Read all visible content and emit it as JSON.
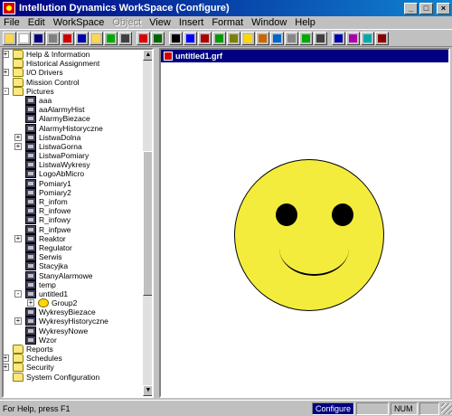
{
  "window": {
    "title": "Intellution Dynamics WorkSpace (Configure)",
    "min_label": "_",
    "max_label": "□",
    "close_label": "×"
  },
  "menu": [
    "File",
    "Edit",
    "WorkSpace",
    "Object",
    "View",
    "Insert",
    "Format",
    "Window",
    "Help"
  ],
  "menu_disabled": [
    "Object"
  ],
  "toolbar_icons": [
    "open-folder-icon",
    "new-icon",
    "save-icon",
    "print-icon",
    "cut-icon",
    "copy-icon",
    "paste-icon",
    "undo-icon",
    "find-icon",
    "draw-tool-icon",
    "scripting-icon",
    "select-icon",
    "rectangle-icon",
    "text-icon",
    "datalink-icon",
    "lock-icon",
    "alarm-icon",
    "chart-icon",
    "bitmap-icon",
    "pushbutton-icon",
    "variable-icon",
    "timer-icon",
    "align-icon",
    "group-icon",
    "ungroup-icon",
    "layer-icon"
  ],
  "tree": {
    "items": [
      {
        "label": "Help & Information",
        "indent": 1,
        "expander": "+",
        "icon": "folder"
      },
      {
        "label": "Historical Assignment",
        "indent": 1,
        "expander": "",
        "icon": "folder"
      },
      {
        "label": "I/O Drivers",
        "indent": 1,
        "expander": "+",
        "icon": "folder"
      },
      {
        "label": "Mission Control",
        "indent": 1,
        "expander": "",
        "icon": "folder"
      },
      {
        "label": "Pictures",
        "indent": 1,
        "expander": "-",
        "icon": "folder"
      },
      {
        "label": "aaa",
        "indent": 2,
        "expander": "",
        "icon": "picture"
      },
      {
        "label": "aaAlarmyHist",
        "indent": 2,
        "expander": "",
        "icon": "picture"
      },
      {
        "label": "AlarmyBiezace",
        "indent": 2,
        "expander": "",
        "icon": "picture"
      },
      {
        "label": "AlarmyHistoryczne",
        "indent": 2,
        "expander": "",
        "icon": "picture"
      },
      {
        "label": "ListwaDolna",
        "indent": 2,
        "expander": "+",
        "icon": "picture"
      },
      {
        "label": "ListwaGorna",
        "indent": 2,
        "expander": "+",
        "icon": "picture"
      },
      {
        "label": "ListwaPomiary",
        "indent": 2,
        "expander": "",
        "icon": "picture"
      },
      {
        "label": "ListwaWykresy",
        "indent": 2,
        "expander": "",
        "icon": "picture"
      },
      {
        "label": "LogoAbMicro",
        "indent": 2,
        "expander": "",
        "icon": "picture"
      },
      {
        "label": "Pomiary1",
        "indent": 2,
        "expander": "",
        "icon": "picture"
      },
      {
        "label": "Pomiary2",
        "indent": 2,
        "expander": "",
        "icon": "picture"
      },
      {
        "label": "R_infom",
        "indent": 2,
        "expander": "",
        "icon": "picture"
      },
      {
        "label": "R_infowe",
        "indent": 2,
        "expander": "",
        "icon": "picture"
      },
      {
        "label": "R_infowy",
        "indent": 2,
        "expander": "",
        "icon": "picture"
      },
      {
        "label": "R_infpwe",
        "indent": 2,
        "expander": "",
        "icon": "picture"
      },
      {
        "label": "Reaktor",
        "indent": 2,
        "expander": "+",
        "icon": "picture"
      },
      {
        "label": "Regulator",
        "indent": 2,
        "expander": "",
        "icon": "picture"
      },
      {
        "label": "Serwis",
        "indent": 2,
        "expander": "",
        "icon": "picture"
      },
      {
        "label": "Stacyjka",
        "indent": 2,
        "expander": "",
        "icon": "picture"
      },
      {
        "label": "StanyAlarmowe",
        "indent": 2,
        "expander": "",
        "icon": "picture"
      },
      {
        "label": "temp",
        "indent": 2,
        "expander": "",
        "icon": "picture"
      },
      {
        "label": "untitled1",
        "indent": 2,
        "expander": "-",
        "icon": "picture"
      },
      {
        "label": "Group2",
        "indent": 3,
        "expander": "+",
        "icon": "group"
      },
      {
        "label": "WykresyBiezace",
        "indent": 2,
        "expander": "",
        "icon": "picture"
      },
      {
        "label": "WykresyHistoryczne",
        "indent": 2,
        "expander": "+",
        "icon": "picture"
      },
      {
        "label": "WykresyNowe",
        "indent": 2,
        "expander": "",
        "icon": "picture"
      },
      {
        "label": "Wzor",
        "indent": 2,
        "expander": "",
        "icon": "picture"
      },
      {
        "label": "Reports",
        "indent": 1,
        "expander": "",
        "icon": "folder"
      },
      {
        "label": "Schedules",
        "indent": 1,
        "expander": "+",
        "icon": "folder"
      },
      {
        "label": "Security",
        "indent": 1,
        "expander": "+",
        "icon": "folder"
      },
      {
        "label": "System Configuration",
        "indent": 1,
        "expander": "",
        "icon": "folder"
      }
    ]
  },
  "document": {
    "title": "untitled1.grf",
    "face_color": "#f4ec3c"
  },
  "status": {
    "text": "For Help, press F1",
    "mode": "Configure",
    "num": "NUM"
  }
}
